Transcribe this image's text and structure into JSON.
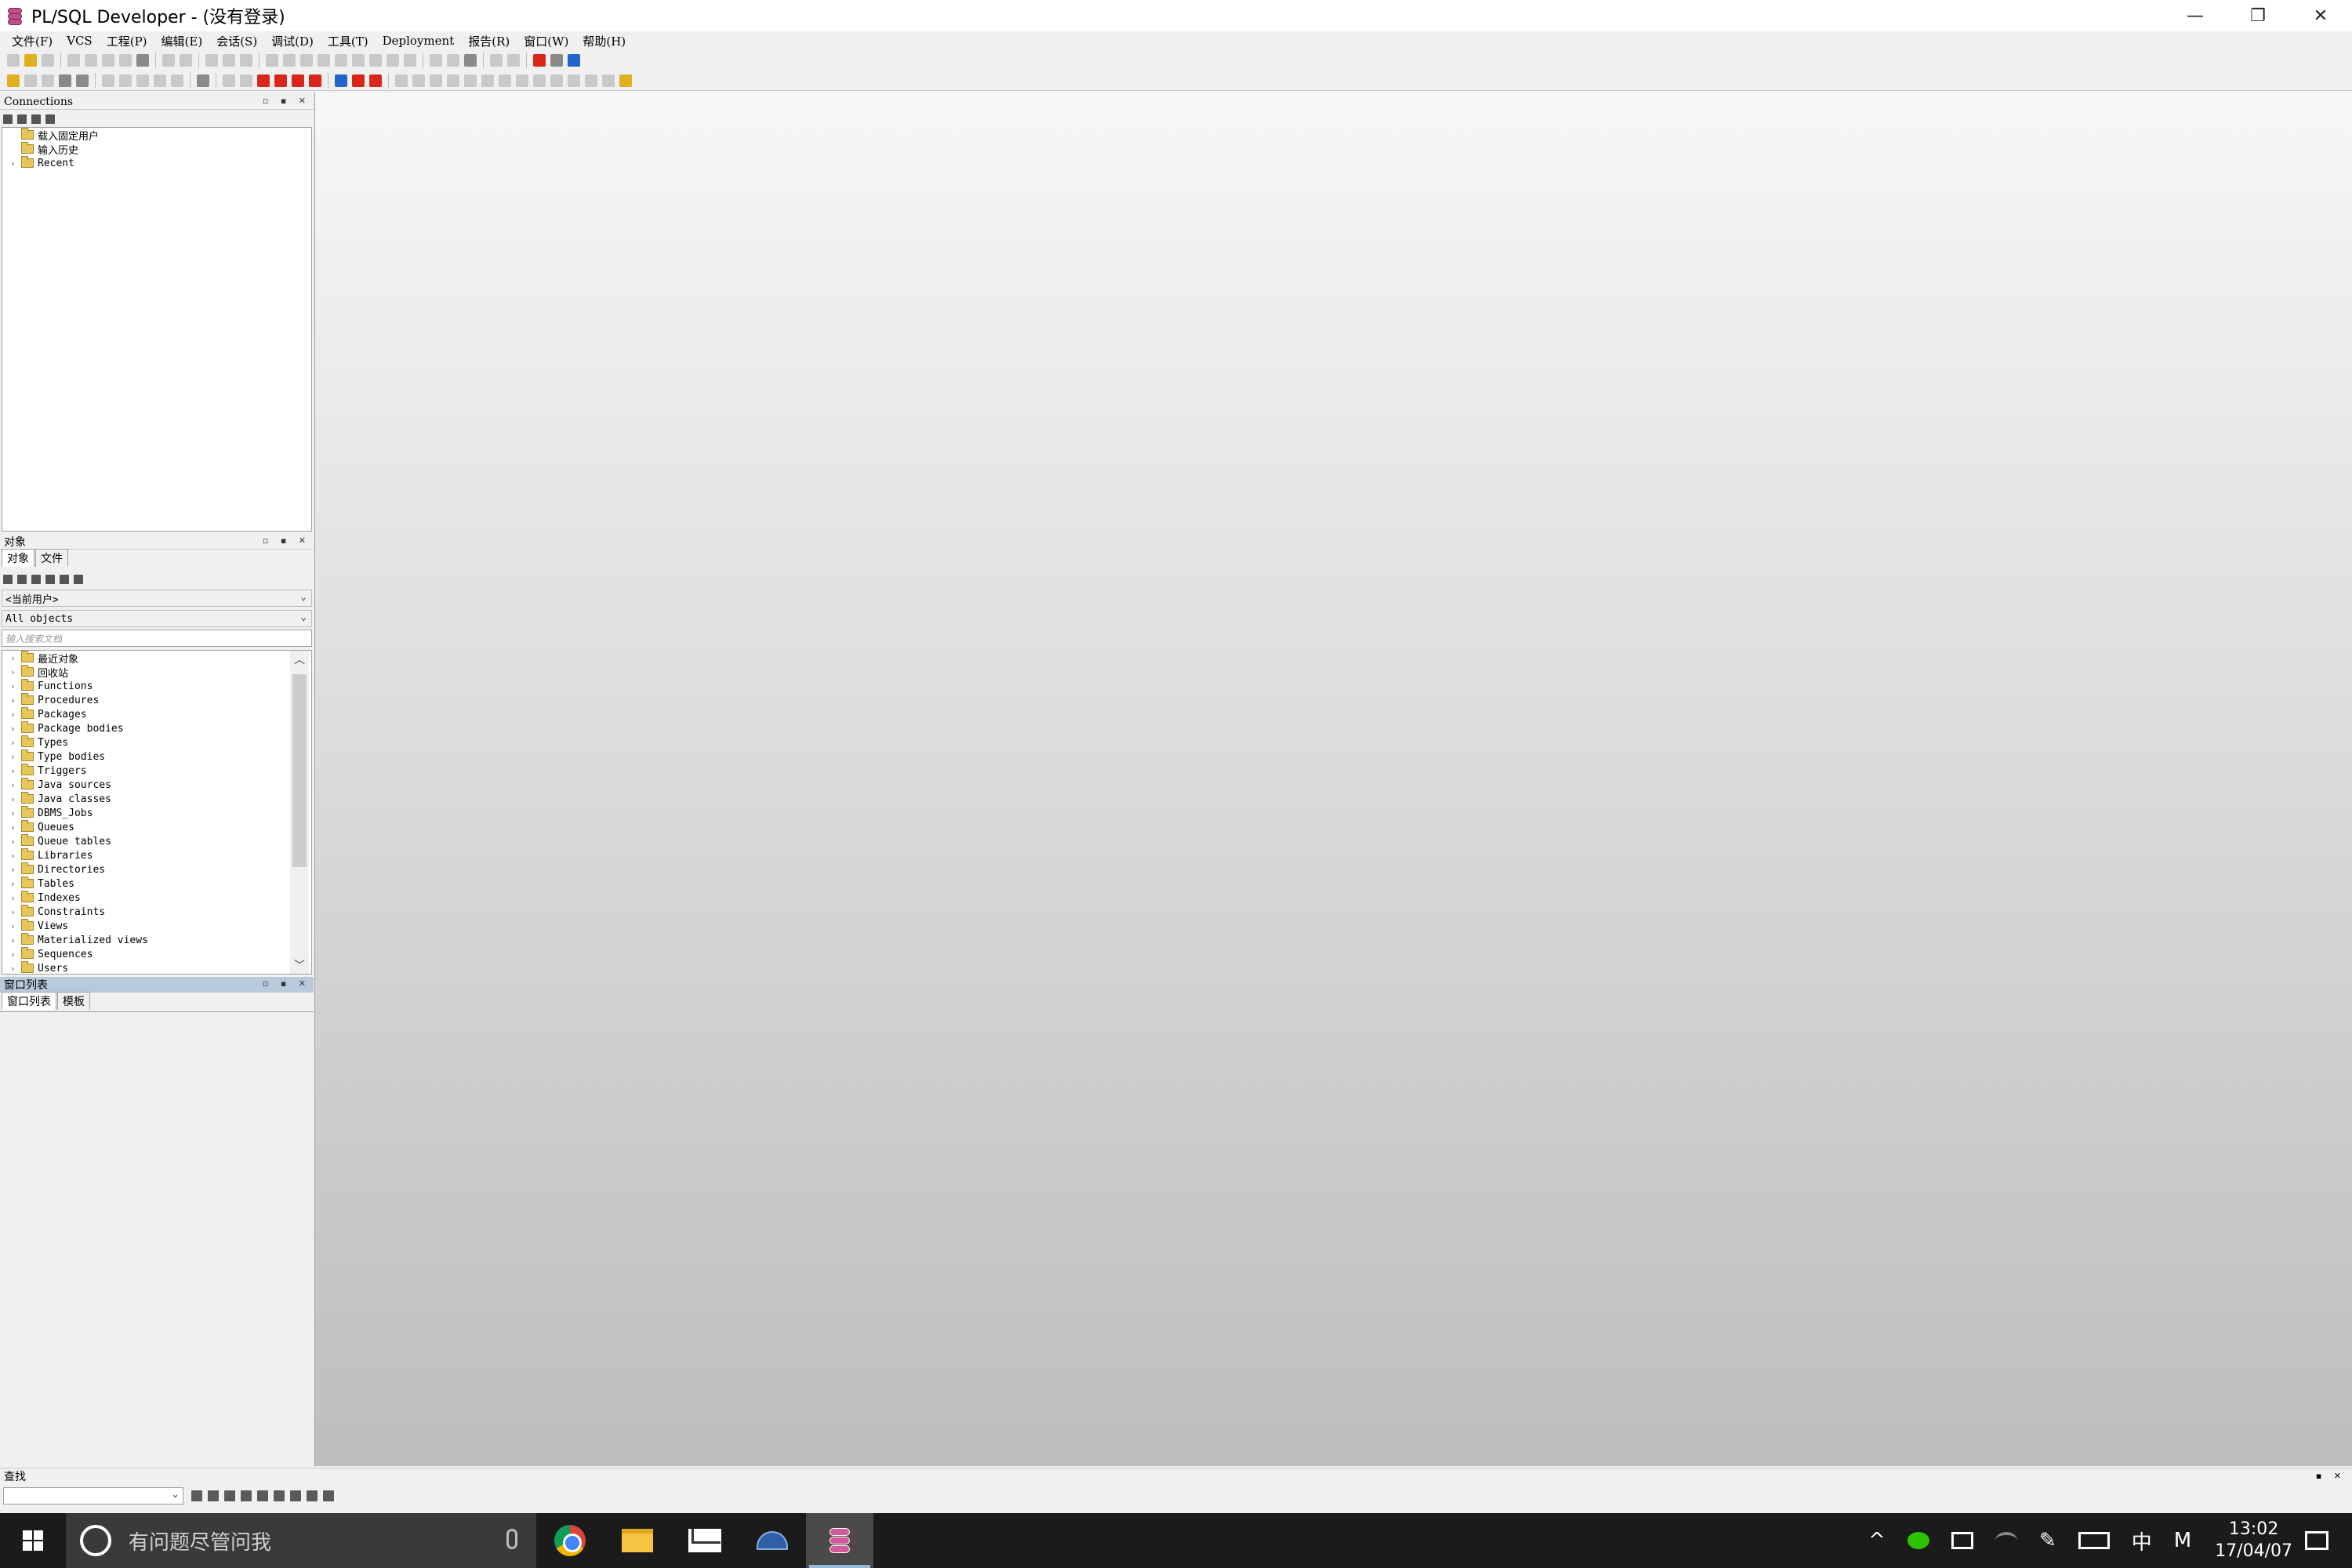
{
  "window": {
    "title": "PL/SQL Developer - (没有登录)",
    "controls": [
      "—",
      "❐",
      "✕"
    ]
  },
  "menu": [
    "文件(F)",
    "VCS",
    "工程(P)",
    "编辑(E)",
    "会话(S)",
    "调试(D)",
    "工具(T)",
    "Deployment",
    "报告(R)",
    "窗口(W)",
    "帮助(H)"
  ],
  "connections": {
    "title": "Connections",
    "items": [
      {
        "label": "载入固定用户",
        "expandable": false
      },
      {
        "label": "输入历史",
        "expandable": false
      },
      {
        "label": "Recent",
        "expandable": true
      }
    ]
  },
  "objects": {
    "title": "对象",
    "tabs": [
      "对象",
      "文件"
    ],
    "user_select": "<当前用户>",
    "type_select": "All objects",
    "filter_placeholder": "输入搜索文档",
    "items": [
      "最近对象",
      "回收站",
      "Functions",
      "Procedures",
      "Packages",
      "Package bodies",
      "Types",
      "Type bodies",
      "Triggers",
      "Java sources",
      "Java classes",
      "DBMS_Jobs",
      "Queues",
      "Queue tables",
      "Libraries",
      "Directories",
      "Tables",
      "Indexes",
      "Constraints",
      "Views",
      "Materialized views",
      "Sequences",
      "Users"
    ]
  },
  "window_list": {
    "title": "窗口列表",
    "tabs": [
      "窗口列表",
      "模板"
    ]
  },
  "find": {
    "title": "查找",
    "value": ""
  },
  "taskbar": {
    "search_placeholder": "有问题尽管问我",
    "ime": "中",
    "ime_mode": "M",
    "time": "13:02",
    "date": "17/04/07"
  }
}
